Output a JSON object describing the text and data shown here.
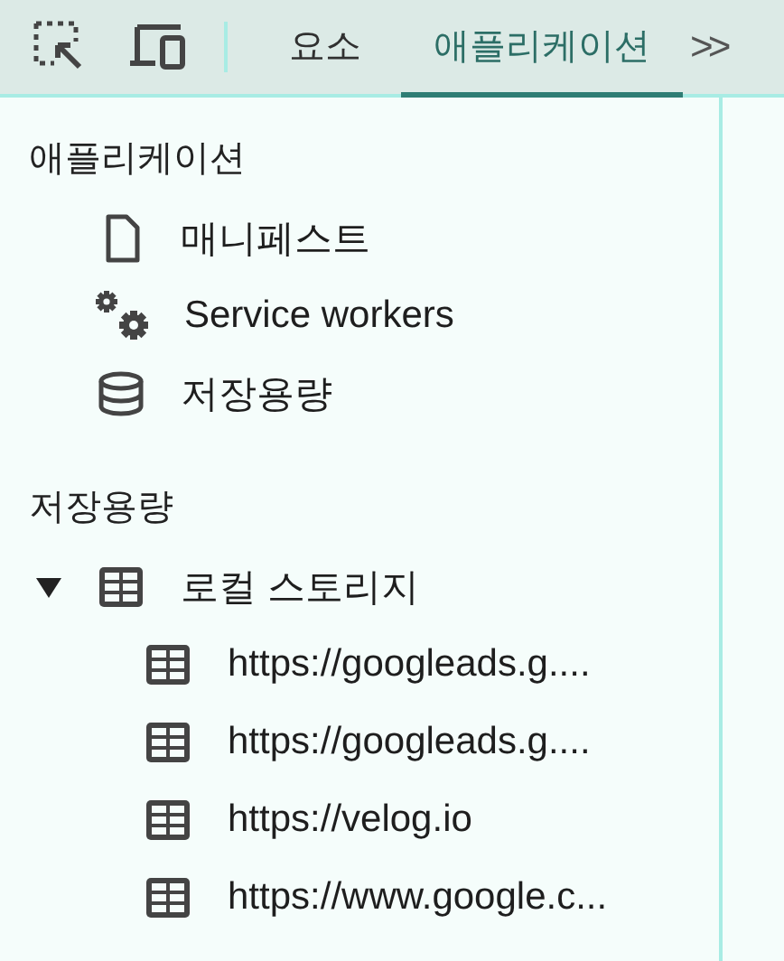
{
  "toolbar": {
    "tabs": [
      {
        "label": "요소",
        "selected": false
      },
      {
        "label": "애플리케이션",
        "selected": true
      }
    ],
    "more": ">>"
  },
  "sections": [
    {
      "title": "애플리케이션",
      "items": [
        {
          "label": "매니페스트",
          "kind": "file"
        },
        {
          "label": "Service workers",
          "kind": "gears"
        },
        {
          "label": "저장용량",
          "kind": "database"
        }
      ]
    },
    {
      "title": "저장용량",
      "items": [
        {
          "label": "로컬 스토리지",
          "kind": "table",
          "expanded": true,
          "children": [
            {
              "label": "https://googleads.g....",
              "kind": "table"
            },
            {
              "label": "https://googleads.g....",
              "kind": "table"
            },
            {
              "label": "https://velog.io",
              "kind": "table"
            },
            {
              "label": "https://www.google.c...",
              "kind": "table"
            }
          ]
        }
      ]
    }
  ]
}
